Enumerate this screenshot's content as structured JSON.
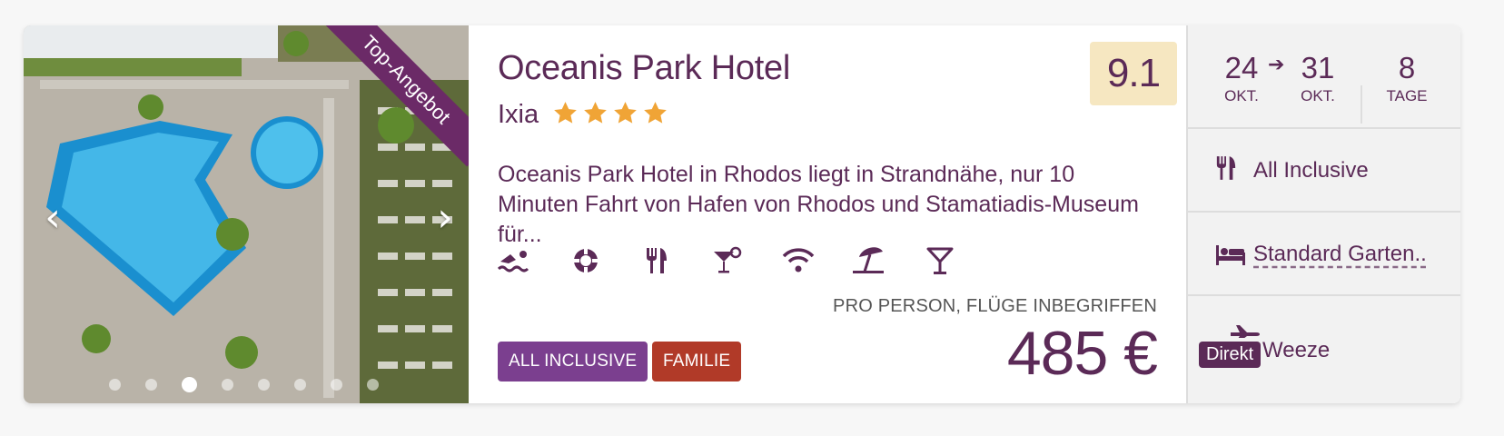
{
  "hotel": {
    "name": "Oceanis Park Hotel",
    "location": "Ixia",
    "stars": 4,
    "rating": "9.1",
    "description": "Oceanis Park Hotel in Rhodos liegt in Strandnähe, nur 10 Minuten Fahrt von Hafen von Rhodos und Stamatiadis-Museum für..."
  },
  "media": {
    "ribbon": "Top-Angebot",
    "prev_icon": "chevron-left-icon",
    "next_icon": "chevron-right-icon",
    "dot_count": 8,
    "active_dot": 3
  },
  "amenities": [
    "swimming-icon",
    "lifebuoy-icon",
    "restaurant-icon",
    "cocktail-icon",
    "wifi-icon",
    "beach-umbrella-icon",
    "bar-icon"
  ],
  "tags": {
    "all_inclusive": "ALL INCLUSIVE",
    "family": "FAMILIE"
  },
  "price": {
    "note": "PRO PERSON, FLÜGE INBEGRIFFEN",
    "amount": "485 €"
  },
  "trip": {
    "from_day": "24",
    "from_month": "OKT.",
    "to_day": "31",
    "to_month": "OKT.",
    "days": "8",
    "days_label": "TAGE",
    "arrow": "➔",
    "board": "All Inclusive",
    "room": "Standard Garten..",
    "flight_badge": "Direkt",
    "airport": "Weeze"
  },
  "colors": {
    "primary": "#5b2a57",
    "ribbon": "#6b2a67",
    "rating_bg": "#f6e7c1",
    "tag_all_inclusive": "#7b3f8f",
    "tag_family": "#b13a28",
    "star": "#f0a436",
    "panel_bg": "#f2f2f2"
  }
}
